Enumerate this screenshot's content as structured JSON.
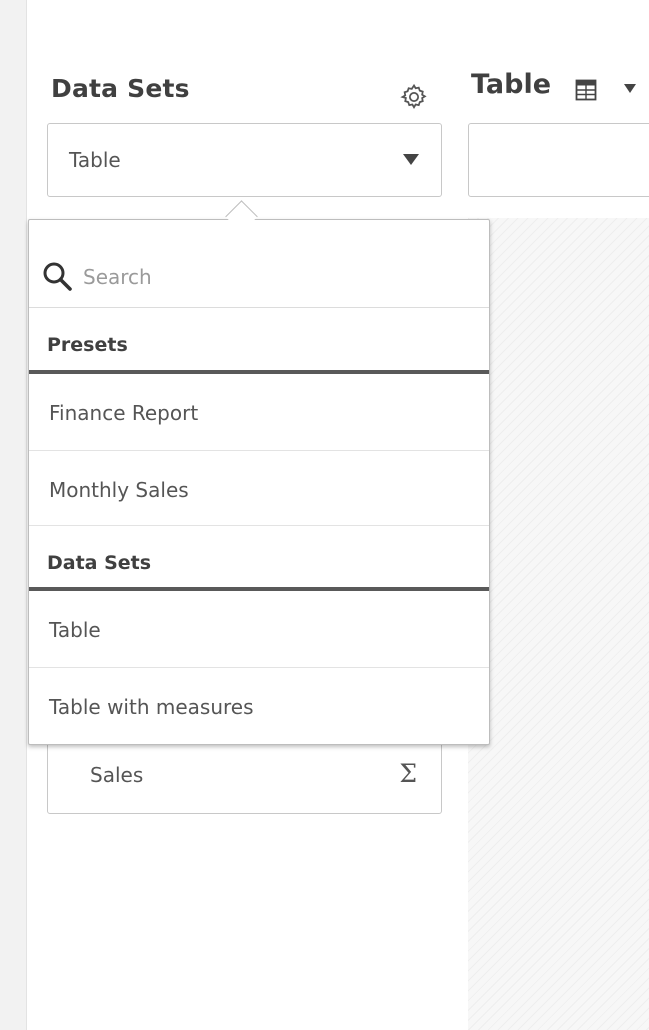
{
  "panel": {
    "title": "Data Sets",
    "dropdown_value": "Table"
  },
  "table": {
    "title": "Table"
  },
  "fields": {
    "sales_label": "Sales",
    "sales_symbol": "Σ"
  },
  "popover": {
    "search_placeholder": "Search",
    "sections": [
      {
        "header": "Presets",
        "items": [
          "Finance Report",
          "Monthly Sales"
        ]
      },
      {
        "header": "Data Sets",
        "items": [
          "Table",
          "Table with measures"
        ]
      }
    ]
  },
  "icons": {
    "settings": "gear-icon",
    "table": "table-grid-icon",
    "search": "search-icon",
    "sum": "sigma-icon"
  },
  "colors": {
    "text": "#404040",
    "divider": "#595959",
    "border": "#c8c8c8"
  }
}
